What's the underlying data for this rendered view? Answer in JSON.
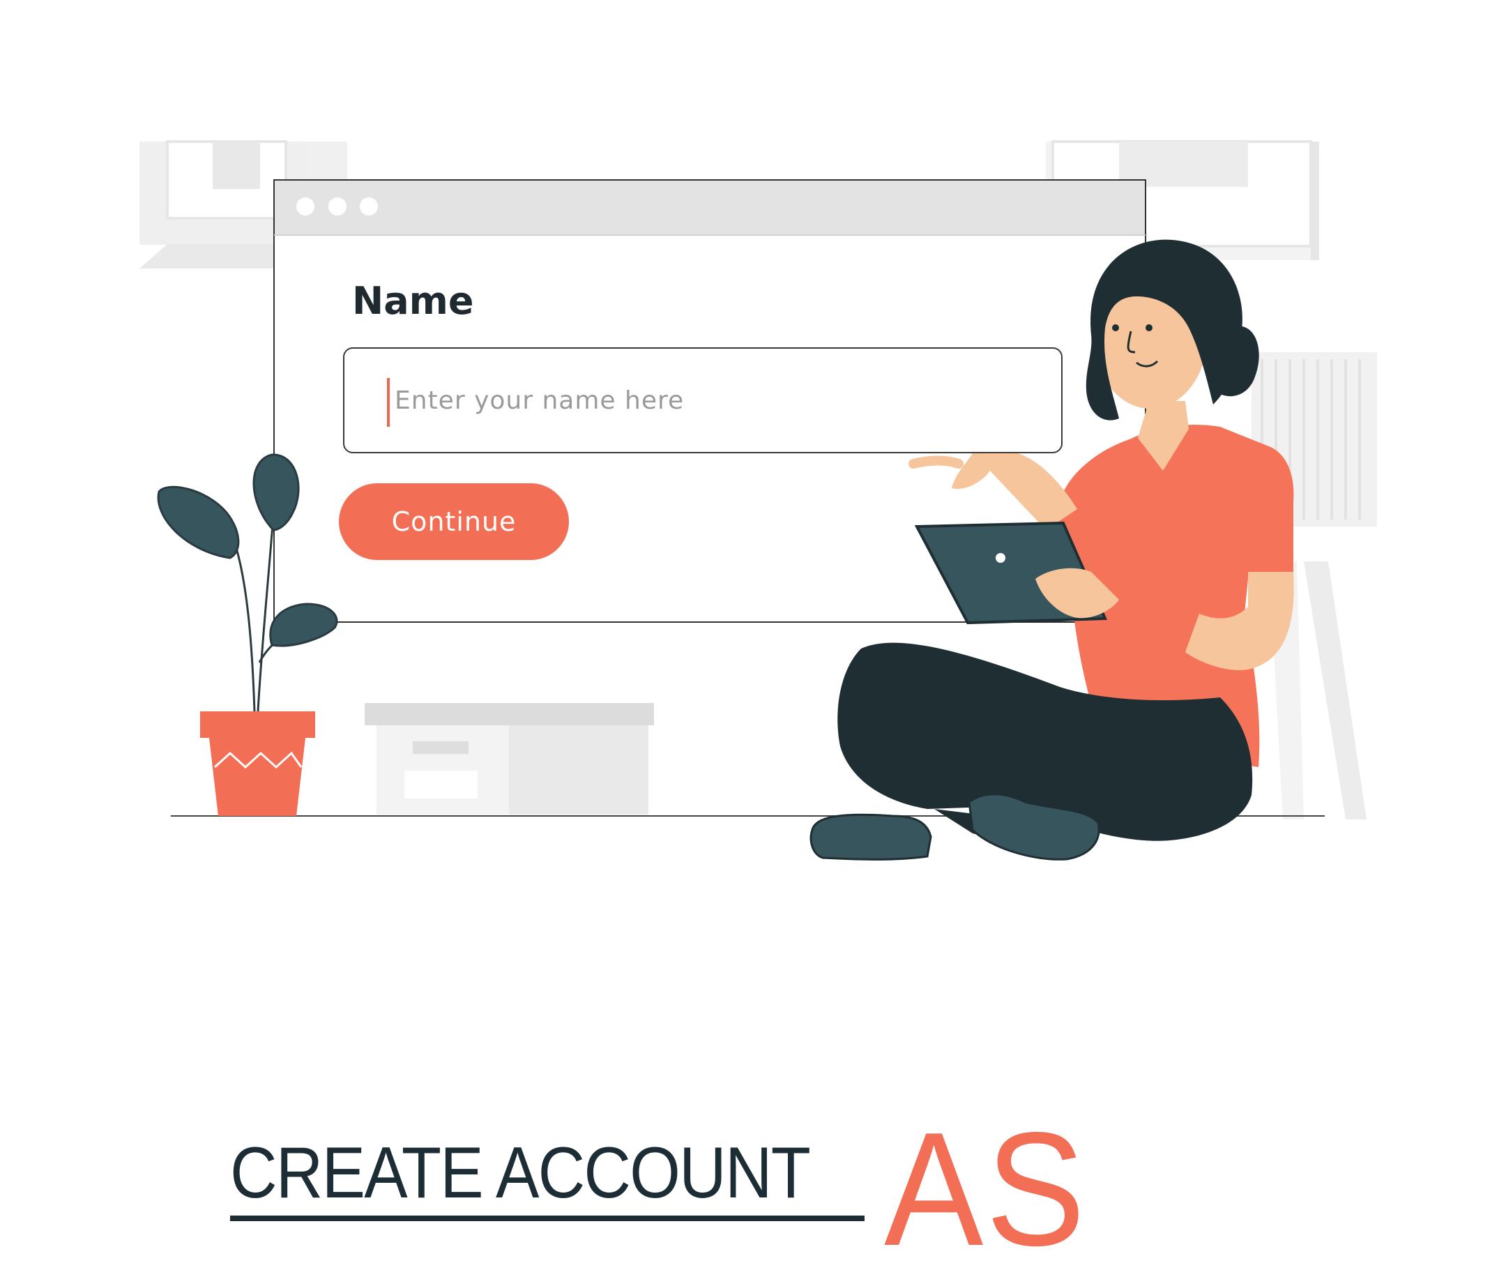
{
  "form": {
    "name_label": "Name",
    "name_placeholder": "Enter your name here",
    "name_value": "",
    "continue_label": "Continue"
  },
  "heading": {
    "main": "CREATE ACCOUNT",
    "accent": "AS"
  },
  "colors": {
    "accent": "#f26e55",
    "dark": "#1d2d35",
    "teal": "#37555d",
    "skin": "#f6c59c",
    "light_gray": "#ececec"
  },
  "icons": {
    "window_controls": "three-dot-window-controls",
    "plant": "potted-plant-illustration",
    "person": "woman-with-tablet-illustration"
  }
}
